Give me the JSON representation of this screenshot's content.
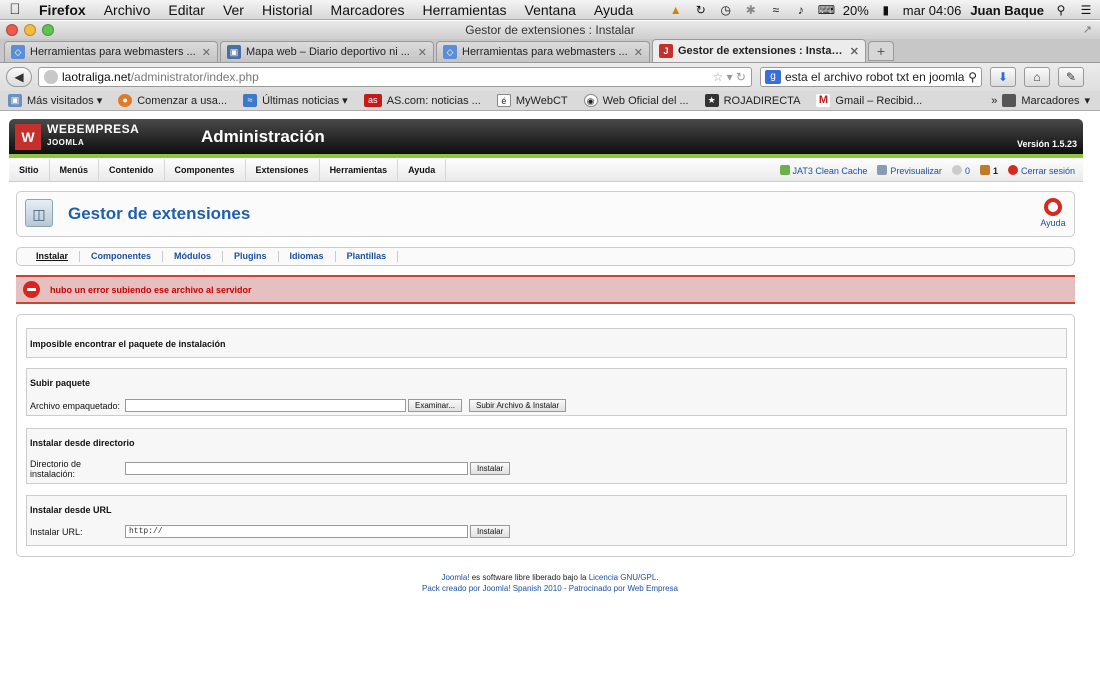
{
  "os_menubar": {
    "app_name": "Firefox",
    "items": [
      "Archivo",
      "Editar",
      "Ver",
      "Historial",
      "Marcadores",
      "Herramientas",
      "Ventana",
      "Ayuda"
    ],
    "battery": "20%",
    "clock": "mar 04:06",
    "user": "Juan Baque"
  },
  "window": {
    "title": "Gestor de extensiones : Instalar"
  },
  "tabs": [
    {
      "label": "Herramientas para webmasters ...",
      "active": false
    },
    {
      "label": "Mapa web – Diario deportivo ni ...",
      "active": false
    },
    {
      "label": "Herramientas para webmasters ...",
      "active": false
    },
    {
      "label": "Gestor de extensiones : Instalar",
      "active": true
    }
  ],
  "url": {
    "domain": "laotraliga.net",
    "path": "/administrator/index.php"
  },
  "search": {
    "value": "esta el archivo robot txt en joomla"
  },
  "bookmarks": [
    {
      "label": "Más visitados",
      "dropdown": true
    },
    {
      "label": "Comenzar a usa...",
      "dropdown": false
    },
    {
      "label": "Últimas noticias",
      "dropdown": true
    },
    {
      "label": "AS.com: noticias ...",
      "dropdown": false
    },
    {
      "label": "MyWebCT",
      "dropdown": false
    },
    {
      "label": "Web Oficial del ...",
      "dropdown": false
    },
    {
      "label": "ROJADIRECTA",
      "dropdown": false
    },
    {
      "label": "Gmail – Recibid...",
      "dropdown": false
    }
  ],
  "bookmarks_right": "Marcadores",
  "joomla": {
    "brand": "WEBEMPRESA",
    "brand_sub": "JOOMLA",
    "admin_title": "Administración",
    "version": "Versión 1.5.23",
    "menu": [
      "Sitio",
      "Menús",
      "Contenido",
      "Componentes",
      "Extensiones",
      "Herramientas",
      "Ayuda"
    ],
    "status": {
      "cache": "JAT3 Clean Cache",
      "preview": "Previsualizar",
      "messages": "0",
      "users": "1",
      "logout": "Cerrar sesión"
    },
    "page_title": "Gestor de extensiones",
    "help_label": "Ayuda",
    "subnav": [
      "Instalar",
      "Componentes",
      "Módulos",
      "Plugins",
      "Idiomas",
      "Plantillas"
    ],
    "error_message": "hubo un error subiendo ese archivo al servidor",
    "package_notice": "Imposible encontrar el paquete de instalación",
    "upload": {
      "legend": "Subir paquete",
      "label": "Archivo empaquetado:",
      "browse_button": "Examinar...",
      "submit_button": "Subir Archivo & Instalar"
    },
    "directory": {
      "legend": "Instalar desde directorio",
      "label": "Directorio de instalación:",
      "value": "",
      "button": "Instalar"
    },
    "url_install": {
      "legend": "Instalar desde URL",
      "label": "Instalar URL:",
      "value": "http://",
      "button": "Instalar"
    },
    "footer": {
      "line1_pre": "Joomla!",
      "line1_mid": " es software libre liberado bajo la ",
      "line1_link": "Licencia GNU/GPL.",
      "line2": "Pack creado por Joomla! Spanish 2010 - Patrocinado por Web Empresa"
    }
  },
  "colors": {
    "accent_green": "#8cc63f",
    "title_blue": "#1f5fb0",
    "error_bg": "#e6c0c0",
    "error_text": "#cc0000"
  }
}
